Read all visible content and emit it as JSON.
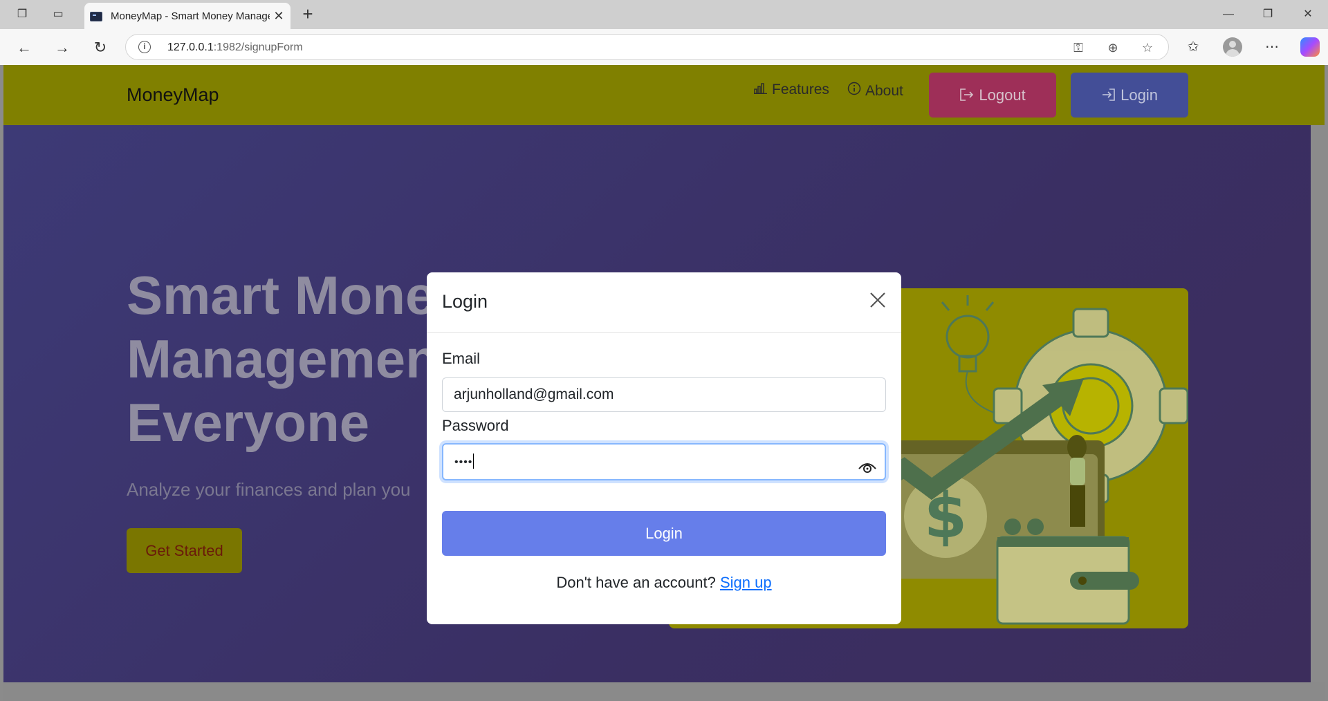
{
  "browser": {
    "tab_title": "MoneyMap - Smart Money Management",
    "url_host": "127.0.0.1",
    "url_rest": ":1982/signupForm",
    "new_tab_symbol": "+",
    "close_symbol": "✕"
  },
  "navbar": {
    "brand": "MoneyMap",
    "features_label": "Features",
    "about_label": "About",
    "logout_label": "Logout",
    "login_label": "Login"
  },
  "hero": {
    "title": "Smart Money Management Everyone",
    "subtitle": "Analyze your finances and plan you",
    "cta_label": "Get Started"
  },
  "modal": {
    "title": "Login",
    "email_label": "Email",
    "email_value": "arjunholland@gmail.com",
    "password_label": "Password",
    "password_value": "••••",
    "submit_label": "Login",
    "no_account_text": "Don't have an account?",
    "signup_link": "Sign up"
  },
  "colors": {
    "navbar_bg": "#808000",
    "hero_bg": "#3d3a76",
    "login_button": "#667eea",
    "logout_button": "#9e2f58",
    "link": "#0d6efd"
  }
}
